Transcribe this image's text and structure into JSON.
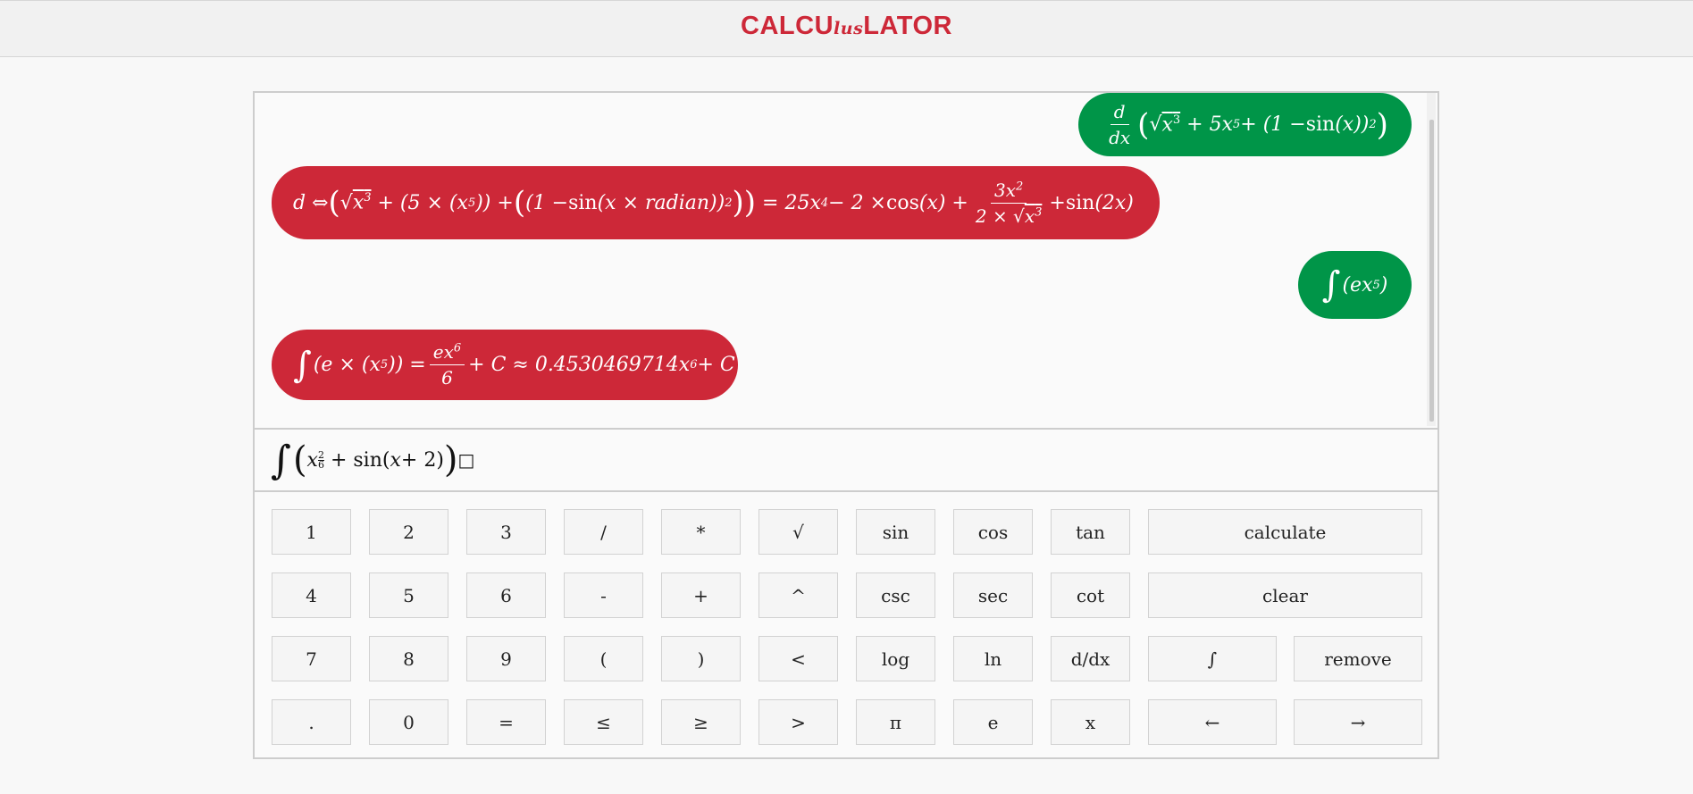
{
  "header": {
    "logo_start": "CALCU",
    "logo_mid": "lus",
    "logo_end": "LATOR"
  },
  "messages": [
    {
      "role": "user",
      "color": "#009548",
      "text": "d/dx(√(x^3) + 5x^5 + (1 − sin(x))^2)"
    },
    {
      "role": "result",
      "color": "#cd2838",
      "text": "d ⇔ (√(x^3) + (5 × (x^5)) + ((1 − sin(x × radian))^2)) = 25x^4 − 2 × cos(x) + 3x^2 / (2 × √(x^3)) + sin(2x)"
    },
    {
      "role": "user",
      "color": "#009548",
      "text": "∫(ex^5)"
    },
    {
      "role": "result",
      "color": "#cd2838",
      "text": "∫(e × (x^5)) = ex^6 / 6 + C ≈ 0.4530469714x^6 + C"
    }
  ],
  "input": {
    "text": "∫(x^(2/6) + sin(x + 2))□"
  },
  "keypad": {
    "keys": [
      "1",
      "2",
      "3",
      "/",
      "*",
      "√",
      "sin",
      "cos",
      "tan",
      "calculate",
      "4",
      "5",
      "6",
      "-",
      "+",
      "^",
      "csc",
      "sec",
      "cot",
      "clear",
      "7",
      "8",
      "9",
      "(",
      ")",
      "<",
      "log",
      "ln",
      "d/dx",
      "∫",
      "remove",
      ".",
      "0",
      "=",
      "≤",
      "≥",
      ">",
      "π",
      "e",
      "x",
      "←",
      "→"
    ]
  }
}
